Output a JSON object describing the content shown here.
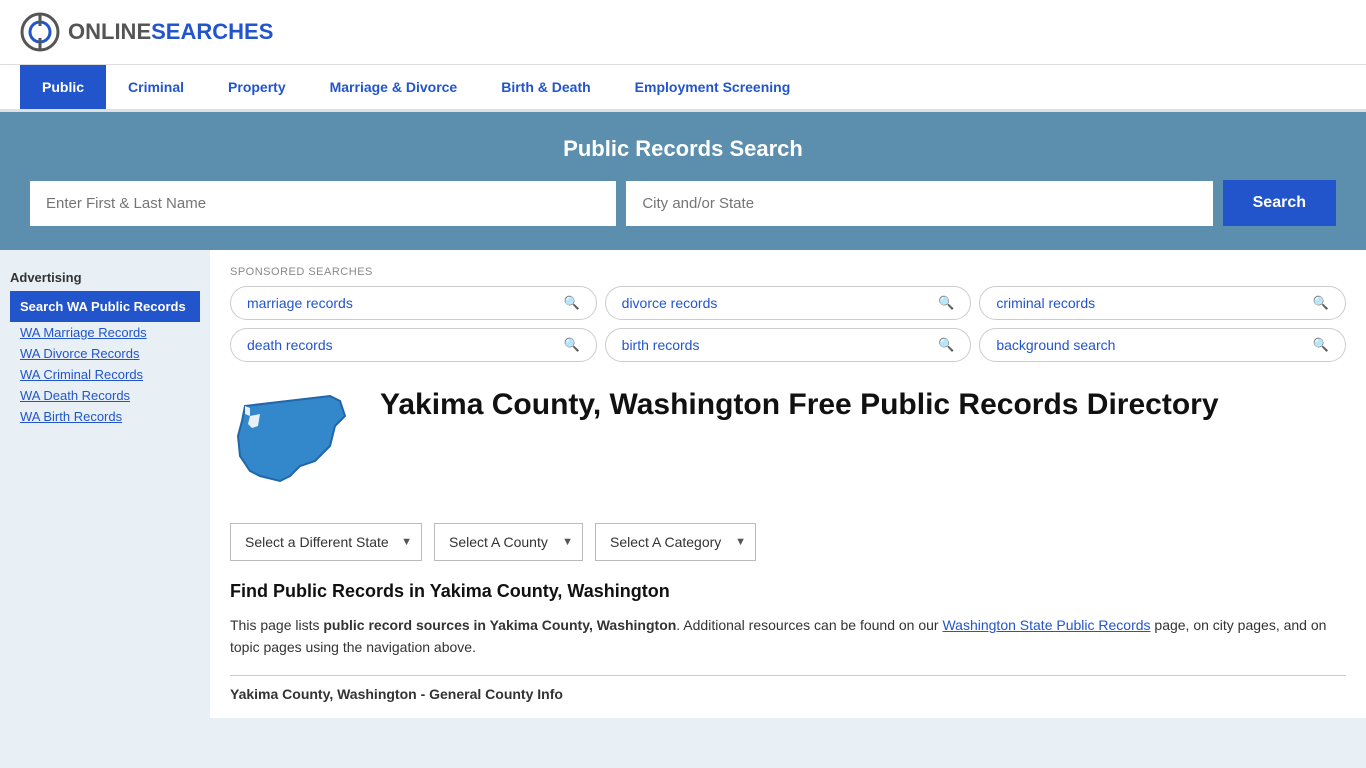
{
  "header": {
    "logo_online": "ONLINE",
    "logo_searches": "SEARCHES"
  },
  "nav": {
    "items": [
      {
        "label": "Public",
        "active": true
      },
      {
        "label": "Criminal",
        "active": false
      },
      {
        "label": "Property",
        "active": false
      },
      {
        "label": "Marriage & Divorce",
        "active": false
      },
      {
        "label": "Birth & Death",
        "active": false
      },
      {
        "label": "Employment Screening",
        "active": false
      }
    ]
  },
  "search_banner": {
    "title": "Public Records Search",
    "name_placeholder": "Enter First & Last Name",
    "location_placeholder": "City and/or State",
    "button_label": "Search"
  },
  "sponsored": {
    "label": "SPONSORED SEARCHES",
    "pills": [
      {
        "label": "marriage records"
      },
      {
        "label": "divorce records"
      },
      {
        "label": "criminal records"
      },
      {
        "label": "death records"
      },
      {
        "label": "birth records"
      },
      {
        "label": "background search"
      }
    ]
  },
  "location": {
    "title": "Yakima County, Washington Free Public Records Directory"
  },
  "dropdowns": {
    "state_label": "Select a Different State",
    "county_label": "Select A County",
    "category_label": "Select A Category"
  },
  "find_section": {
    "title": "Find Public Records in Yakima County, Washington",
    "description_part1": "This page lists ",
    "description_bold": "public record sources in Yakima County, Washington",
    "description_part2": ". Additional resources can be found on our ",
    "link_text": "Washington State Public Records",
    "description_part3": " page, on city pages, and on topic pages using the navigation above."
  },
  "county_info": {
    "title": "Yakima County, Washington - General County Info"
  },
  "sidebar": {
    "ad_label": "Advertising",
    "ad_active_label": "Search WA Public Records",
    "links": [
      {
        "label": "WA Marriage Records"
      },
      {
        "label": "WA Divorce Records"
      },
      {
        "label": "WA Criminal Records"
      },
      {
        "label": "WA Death Records"
      },
      {
        "label": "WA Birth Records"
      }
    ]
  }
}
